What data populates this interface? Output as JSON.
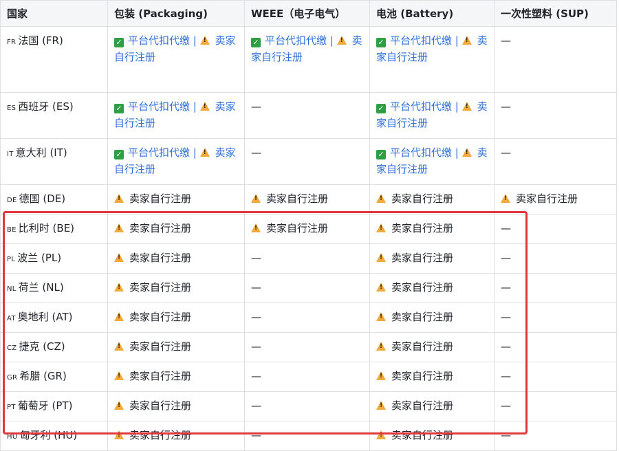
{
  "headers": [
    "国家",
    "包装 (Packaging)",
    "WEEE（电子电气）",
    "电池 (Battery)",
    "一次性塑料 (SUP)"
  ],
  "labels": {
    "platform": "平台代扣代缴 |",
    "seller": "卖家自行注册",
    "none": "—"
  },
  "colors": {
    "accent": "#2f6fd8",
    "check": "#2ea043",
    "warn": "#f2a93b",
    "highlight": "#e0383e"
  },
  "rows": [
    {
      "code": "FR",
      "name": "法国 (FR)",
      "cells": [
        "both",
        "both",
        "both",
        "none"
      ]
    },
    {
      "code": "ES",
      "name": "西班牙 (ES)",
      "cells": [
        "both",
        "none",
        "both",
        "none"
      ]
    },
    {
      "code": "IT",
      "name": "意大利 (IT)",
      "cells": [
        "both",
        "none",
        "both",
        "none"
      ]
    },
    {
      "code": "DE",
      "name": "德国 (DE)",
      "cells": [
        "seller",
        "seller",
        "seller",
        "seller"
      ]
    },
    {
      "code": "BE",
      "name": "比利时 (BE)",
      "cells": [
        "seller",
        "seller",
        "seller",
        "none"
      ]
    },
    {
      "code": "PL",
      "name": "波兰 (PL)",
      "cells": [
        "seller",
        "none",
        "seller",
        "none"
      ]
    },
    {
      "code": "NL",
      "name": "荷兰 (NL)",
      "cells": [
        "seller",
        "none",
        "seller",
        "none"
      ]
    },
    {
      "code": "AT",
      "name": "奥地利 (AT)",
      "cells": [
        "seller",
        "none",
        "seller",
        "none"
      ]
    },
    {
      "code": "CZ",
      "name": "捷克 (CZ)",
      "cells": [
        "seller",
        "none",
        "seller",
        "none"
      ]
    },
    {
      "code": "GR",
      "name": "希腊 (GR)",
      "cells": [
        "seller",
        "none",
        "seller",
        "none"
      ]
    },
    {
      "code": "PT",
      "name": "葡萄牙 (PT)",
      "cells": [
        "seller",
        "none",
        "seller",
        "none"
      ]
    },
    {
      "code": "HU",
      "name": "匈牙利 (HU)",
      "cells": [
        "seller",
        "none",
        "seller",
        "none"
      ]
    }
  ]
}
